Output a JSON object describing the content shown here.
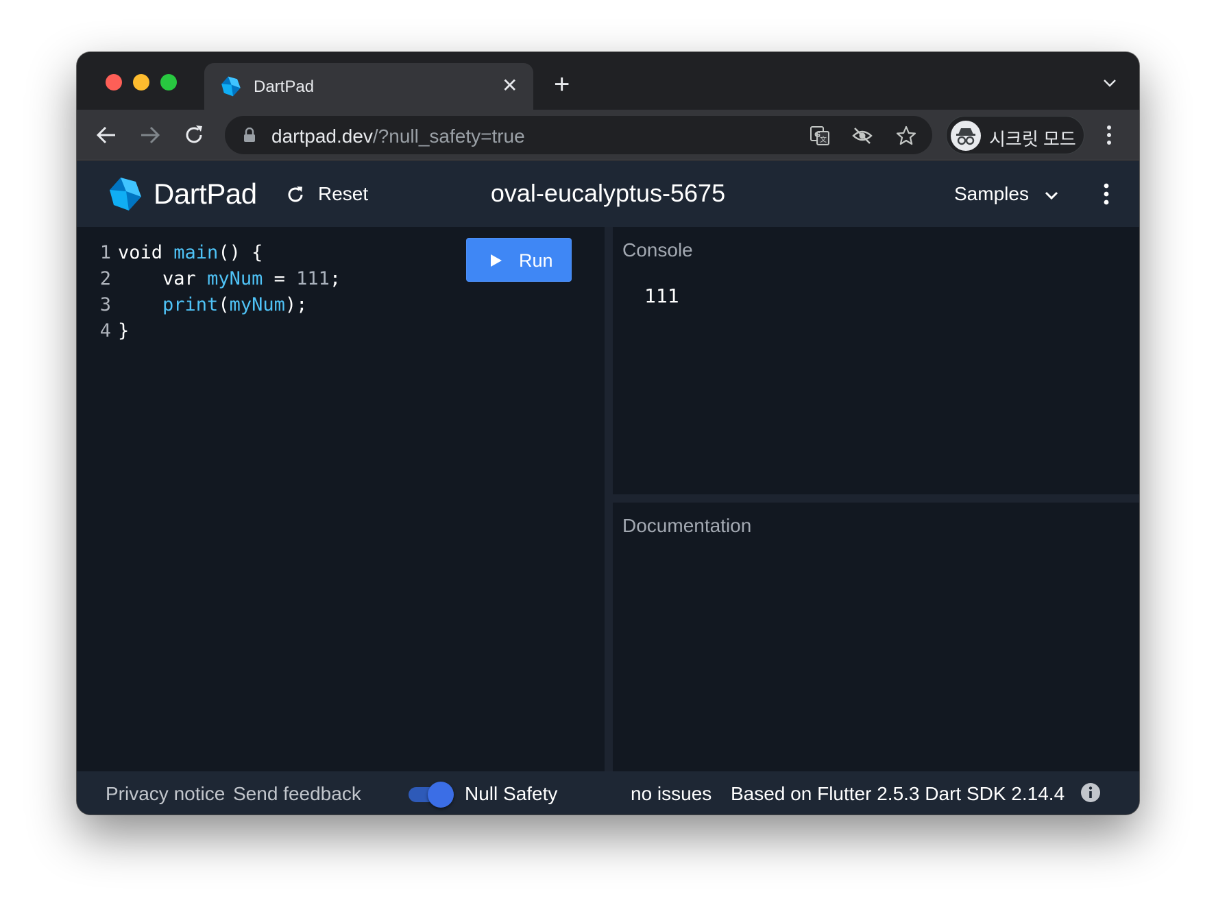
{
  "browser": {
    "tab_title": "DartPad",
    "tab_close_glyph": "✕",
    "new_tab_glyph": "+",
    "url_host": "dartpad.dev",
    "url_path": "/?null_safety=true",
    "profile_label": "시크릿 모드",
    "icons": [
      "back-arrow-icon",
      "forward-arrow-icon",
      "reload-icon",
      "lock-icon",
      "translate-icon",
      "tracking-blocked-eye-icon",
      "bookmark-star-icon",
      "incognito-icon",
      "more-vert-icon",
      "tab-list-chevron-icon"
    ]
  },
  "app": {
    "name": "DartPad",
    "reset_label": "Reset",
    "pad_title": "oval-eucalyptus-5675",
    "samples_label": "Samples",
    "run_label": "Run"
  },
  "editor": {
    "lines": [
      {
        "num": "1",
        "indent": "",
        "tokens": [
          {
            "t": "void ",
            "c": "kw"
          },
          {
            "t": "main",
            "c": "fn"
          },
          {
            "t": "() {",
            "c": "pn"
          }
        ]
      },
      {
        "num": "2",
        "indent": "    ",
        "tokens": [
          {
            "t": "var ",
            "c": "kw"
          },
          {
            "t": "myNum",
            "c": "fn"
          },
          {
            "t": " = ",
            "c": "pn"
          },
          {
            "t": "111",
            "c": "num"
          },
          {
            "t": ";",
            "c": "pn"
          }
        ]
      },
      {
        "num": "3",
        "indent": "    ",
        "tokens": [
          {
            "t": "print",
            "c": "fn"
          },
          {
            "t": "(",
            "c": "pn"
          },
          {
            "t": "myNum",
            "c": "fn"
          },
          {
            "t": ");",
            "c": "pn"
          }
        ]
      },
      {
        "num": "4",
        "indent": "",
        "tokens": [
          {
            "t": "}",
            "c": "pn"
          }
        ]
      }
    ]
  },
  "console": {
    "title": "Console",
    "output": "111"
  },
  "documentation": {
    "title": "Documentation"
  },
  "footer": {
    "privacy_label": "Privacy notice",
    "feedback_label": "Send feedback",
    "null_safety_label": "Null Safety",
    "null_safety_enabled": true,
    "issues_label": "no issues",
    "version_label": "Based on Flutter 2.5.3 Dart SDK 2.14.4"
  },
  "colors": {
    "accent": "#3f87f5",
    "header_bg": "#1e2734",
    "editor_bg": "#121821",
    "identifier": "#4fc3f7"
  }
}
